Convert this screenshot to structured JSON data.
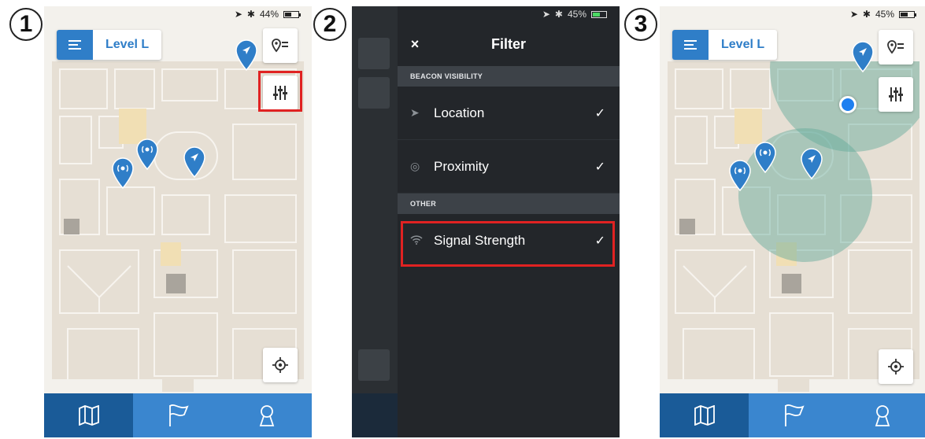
{
  "steps": [
    "1",
    "2",
    "3"
  ],
  "status": {
    "battery_1": "44%",
    "battery_2": "45%",
    "battery_3": "45%"
  },
  "map": {
    "level_label": "Level L"
  },
  "filter": {
    "title": "Filter",
    "close_label": "×",
    "sections": [
      {
        "label": "BEACON VISIBILITY",
        "items": [
          {
            "label": "Location",
            "icon": "location-arrow-icon",
            "checked": true
          },
          {
            "label": "Proximity",
            "icon": "proximity-icon",
            "checked": true
          }
        ]
      },
      {
        "label": "OTHER",
        "items": [
          {
            "label": "Signal Strength",
            "icon": "wifi-icon",
            "checked": true
          }
        ]
      }
    ],
    "check_glyph": "✓"
  },
  "tabs": [
    {
      "icon": "map-icon",
      "active": true
    },
    {
      "icon": "flag-icon",
      "active": false
    },
    {
      "icon": "profile-icon",
      "active": false
    }
  ],
  "colors": {
    "accent": "#2f7ec8",
    "tab_active": "#1a5b98",
    "highlight": "#e02222",
    "signal_circle": "#5fa898"
  }
}
